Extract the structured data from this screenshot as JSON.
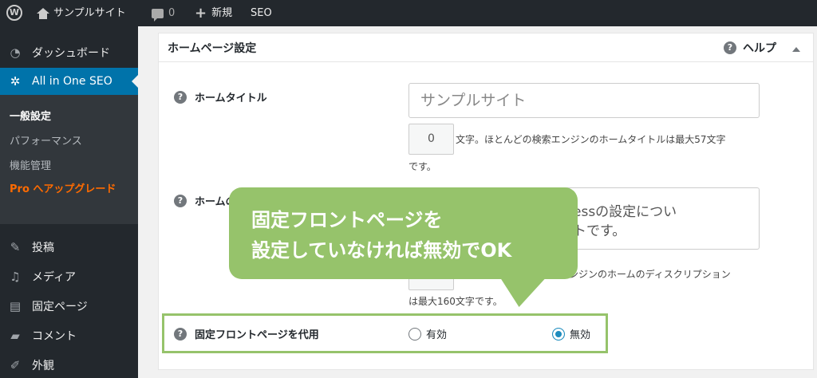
{
  "adminbar": {
    "wp_logo": "W",
    "site_name": "サンプルサイト",
    "comments_count": "0",
    "new_label": "新規",
    "seo_label": "SEO"
  },
  "sidebar": {
    "dashboard": "ダッシュボード",
    "aioseo": "All in One SEO",
    "submenu": {
      "general": "一般設定",
      "performance": "パフォーマンス",
      "features": "機能管理",
      "pro_bold": "Pro",
      "pro_rest": " へアップグレード"
    },
    "posts": "投稿",
    "media": "メディア",
    "pages": "固定ページ",
    "comments": "コメント",
    "appearance": "外観"
  },
  "panel": {
    "title": "ホームページ設定",
    "help": "ヘルプ",
    "home_title_label": "ホームタイトル",
    "home_title_value": "サンプルサイト",
    "title_count": "0",
    "title_note_1": "文字。ほとんどの検索エンジンのホームタイトルは最大57文字",
    "title_note_2": "です。",
    "desc_label": "ホームの",
    "desc_value_1": "essの設定につい",
    "desc_value_2": "トです。",
    "desc_note_1": "索エンジンのホームのディスクリプション",
    "desc_note_2": "は最大160文字です。",
    "front_label": "固定フロントページを代用",
    "radio_yes": "有効",
    "radio_no": "無効"
  },
  "callout": {
    "line1": "固定フロントページを",
    "line2": "設定していなければ無効でOK"
  },
  "colors": {
    "accent_blue": "#0073aa",
    "callout_green": "#96c36b",
    "pro_orange": "#ff6b00"
  }
}
